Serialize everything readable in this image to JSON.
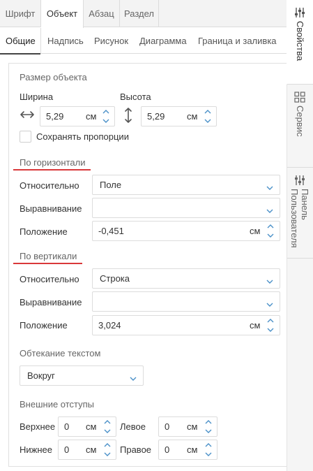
{
  "top_tabs": [
    "Шрифт",
    "Объект",
    "Абзац",
    "Раздел"
  ],
  "sub_tabs": [
    "Общие",
    "Надпись",
    "Рисунок",
    "Диаграмма",
    "Граница и заливка"
  ],
  "size": {
    "title": "Размер объекта",
    "width_label": "Ширина",
    "height_label": "Высота",
    "width_value": "5,29",
    "height_value": "5,29",
    "unit": "см",
    "keep_ratio_label": "Сохранять пропорции"
  },
  "horizontal": {
    "title": "По горизонтали",
    "relative_label": "Относительно",
    "relative_value": "Поле",
    "align_label": "Выравнивание",
    "align_value": "",
    "position_label": "Положение",
    "position_value": "-0,451",
    "unit": "см"
  },
  "vertical": {
    "title": "По вертикали",
    "relative_label": "Относительно",
    "relative_value": "Строка",
    "align_label": "Выравнивание",
    "align_value": "",
    "position_label": "Положение",
    "position_value": "3,024",
    "unit": "см"
  },
  "wrap": {
    "title": "Обтекание текстом",
    "value": "Вокруг"
  },
  "margins": {
    "title": "Внешние отступы",
    "top_label": "Верхнее",
    "top_value": "0",
    "left_label": "Левое",
    "left_value": "0",
    "bottom_label": "Нижнее",
    "bottom_value": "0",
    "right_label": "Правое",
    "right_value": "0",
    "unit": "см"
  },
  "side_tabs": [
    "Свойства",
    "Сервис",
    "Панель\nПользователя"
  ],
  "colors": {
    "accent": "#d9383a",
    "spinner": "#4a90c8"
  }
}
